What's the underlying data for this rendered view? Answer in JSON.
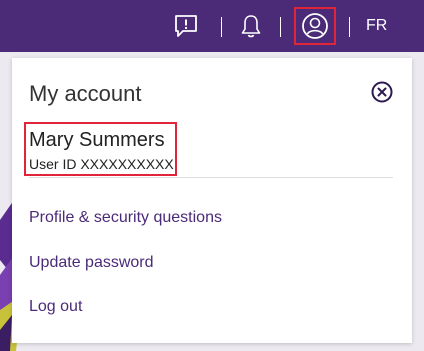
{
  "colors": {
    "topbar": "#4b2a78",
    "link": "#4b2a78",
    "highlight": "#e0243a"
  },
  "topbar": {
    "icons": [
      "feedback-icon",
      "notifications-icon",
      "profile-icon"
    ],
    "language": "FR"
  },
  "account_panel": {
    "title": "My account",
    "close_icon": "close-circle-icon",
    "user": {
      "name": "Mary Summers",
      "user_id": "User ID XXXXXXXXXX"
    },
    "links": [
      {
        "label": "Profile & security questions"
      },
      {
        "label": "Update password"
      },
      {
        "label": "Log out"
      }
    ]
  }
}
